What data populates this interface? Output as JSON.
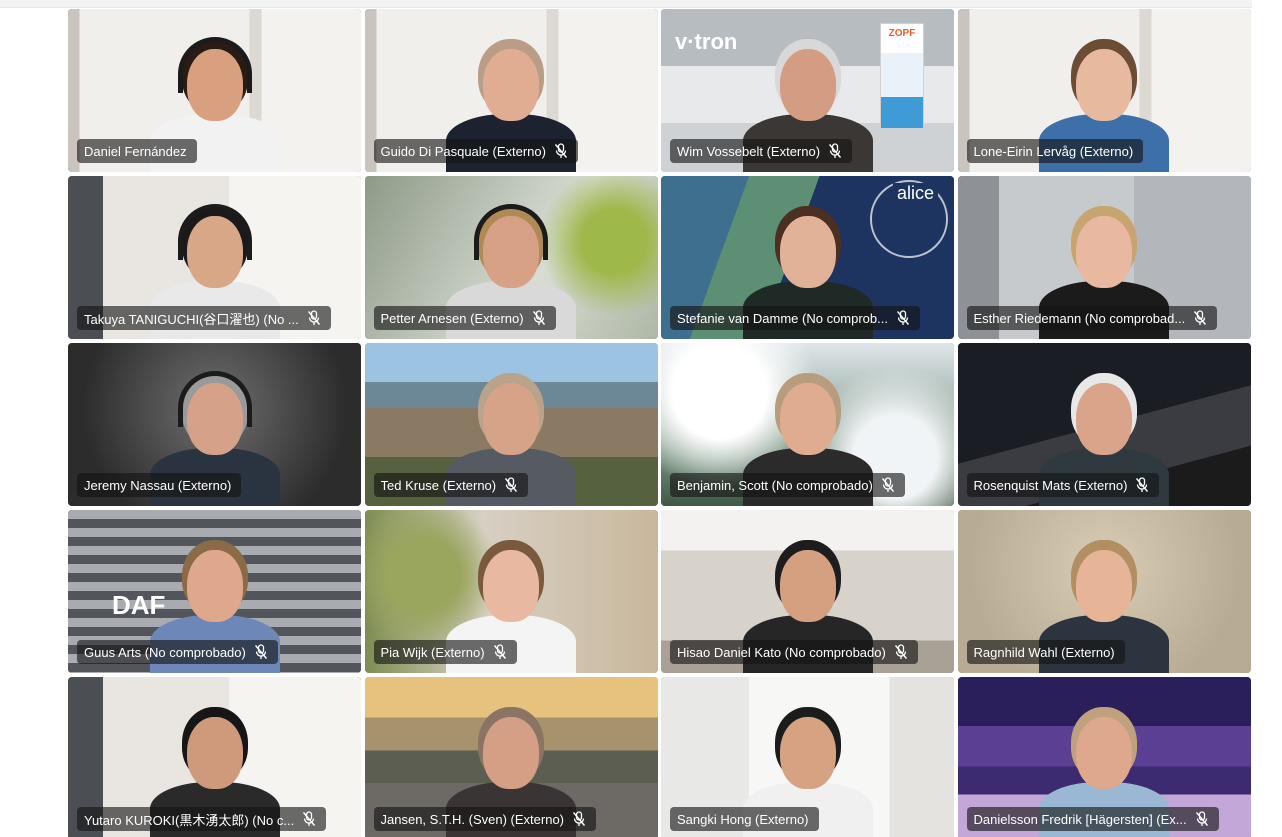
{
  "participants": [
    {
      "name": "Daniel Fernández",
      "muted": false,
      "scene": "white-room",
      "hair": "#2a1c14",
      "shirt": "#f2f2f2",
      "skin": "#d9a07f",
      "headset": true
    },
    {
      "name": "Guido Di Pasquale (Externo)",
      "muted": true,
      "scene": "white-room",
      "hair": "#b99d86",
      "shirt": "#1c2230",
      "skin": "#e0ad92",
      "headset": false
    },
    {
      "name": "Wim Vossebelt (Externo)",
      "muted": true,
      "scene": "office-logo",
      "hair": "#d8d8d8",
      "shirt": "#3b3735",
      "skin": "#d49c82",
      "headset": false,
      "logo": "v·tron",
      "banner_brand": "ZOPF"
    },
    {
      "name": "Lone-Eirin Lervåg (Externo)",
      "muted": false,
      "scene": "white-room",
      "hair": "#6b4c35",
      "shirt": "#3d6fa8",
      "skin": "#e7b99e",
      "headset": false
    },
    {
      "name": "Takuya TANIGUCHI(谷口濯也) (No ...",
      "muted": true,
      "scene": "white-room-window",
      "hair": "#1a1a1a",
      "shirt": "#e9e9e9",
      "skin": "#d8a787",
      "headset": true
    },
    {
      "name": "Petter Arnesen (Externo)",
      "muted": true,
      "scene": "blurred-green",
      "hair": "#b08a55",
      "shirt": "#d9d9d9",
      "skin": "#d7a185",
      "headset": true
    },
    {
      "name": "Stefanie van Damme (No comprob...",
      "muted": true,
      "scene": "alice-poster",
      "hair": "#4a2f22",
      "shirt": "#1f2a26",
      "skin": "#e1b298",
      "headset": false,
      "badge": "alice"
    },
    {
      "name": "Esther Riedemann (No comprobad...",
      "muted": true,
      "scene": "grey-room",
      "hair": "#c7a470",
      "shirt": "#1b1b1b",
      "skin": "#e8b8a0",
      "headset": false
    },
    {
      "name": "Jeremy Nassau (Externo)",
      "muted": false,
      "scene": "dark-grey",
      "hair": "#9a9a9a",
      "shirt": "#2a3340",
      "skin": "#d5a289",
      "headset": true
    },
    {
      "name": "Ted Kruse (Externo)",
      "muted": true,
      "scene": "city-aerial",
      "hair": "#b9a38b",
      "shirt": "#555a63",
      "skin": "#d6a388",
      "headset": false
    },
    {
      "name": "Benjamin, Scott (No comprobado)",
      "muted": true,
      "scene": "cloud-forest",
      "hair": "#b89c7e",
      "shirt": "#2b2b2b",
      "skin": "#e0ac90",
      "headset": false
    },
    {
      "name": "Rosenquist Mats (Externo)",
      "muted": true,
      "scene": "night-road",
      "hair": "#e8e8e8",
      "shirt": "#2e3a40",
      "skin": "#d9a489",
      "headset": false
    },
    {
      "name": "Guus Arts (No comprobado)",
      "muted": true,
      "scene": "truck-grille",
      "hair": "#8b6a48",
      "shirt": "#6d87b8",
      "skin": "#dfa88c",
      "headset": false,
      "logo": "DAF"
    },
    {
      "name": "Pia Wijk (Externo)",
      "muted": true,
      "scene": "blurred-warm",
      "hair": "#7a5a3e",
      "shirt": "#f4f4f4",
      "skin": "#e8b9a0",
      "headset": false
    },
    {
      "name": "Hisao Daniel Kato (No comprobado)",
      "muted": true,
      "scene": "bright-loft",
      "hair": "#1d1d1d",
      "shirt": "#262626",
      "skin": "#d5a080",
      "headset": false
    },
    {
      "name": "Ragnhild Wahl (Externo)",
      "muted": false,
      "scene": "beige-wall",
      "hair": "#b18f62",
      "shirt": "#2c3440",
      "skin": "#e6b497",
      "headset": false
    },
    {
      "name": "Yutaro KUROKI(黒木湧太郎) (No c...",
      "muted": true,
      "scene": "white-room-window",
      "hair": "#161616",
      "shirt": "#2a2a2a",
      "skin": "#cf9a7b",
      "headset": false
    },
    {
      "name": "Jansen, S.T.H. (Sven) (Externo)",
      "muted": true,
      "scene": "sunset-car",
      "hair": "#8a7565",
      "shirt": "#3a3434",
      "skin": "#d59f86",
      "headset": false
    },
    {
      "name": "Sangki Hong (Externo)",
      "muted": false,
      "scene": "white-lounge",
      "hair": "#1c1c1c",
      "shirt": "#f0f0f0",
      "skin": "#d6a282",
      "headset": false
    },
    {
      "name": "Danielsson Fredrik [Hägersten] (Ex...",
      "muted": true,
      "scene": "purple-mountains",
      "hair": "#c0a17d",
      "shirt": "#9ab7d4",
      "skin": "#dea88d",
      "headset": false
    }
  ]
}
